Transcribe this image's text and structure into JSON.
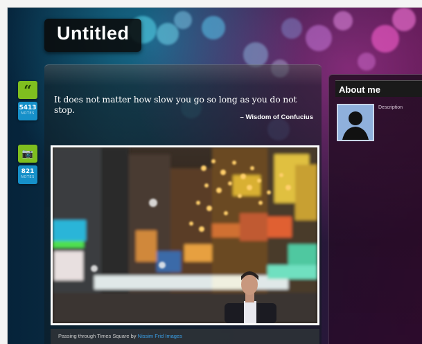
{
  "blog": {
    "title": "Untitled"
  },
  "sidebar_icons": [
    {
      "icon": "quote-icon",
      "glyph": "“",
      "count": "5413",
      "count_label": "NOTES"
    },
    {
      "icon": "camera-icon",
      "glyph": "📷",
      "count": "821",
      "count_label": "NOTES"
    }
  ],
  "quote": {
    "text": "It does not matter how slow you go so long as you do not stop.",
    "source": "– Wisdom of Confucius"
  },
  "photo": {
    "caption": "Passing through Times Square by ",
    "caption_link": "Nissim Frid Images"
  },
  "about": {
    "title": "About me",
    "description": "Description"
  },
  "colors": {
    "accent_green": "#7fbf1f",
    "accent_blue": "#1690c9",
    "link": "#3aa0e8"
  }
}
